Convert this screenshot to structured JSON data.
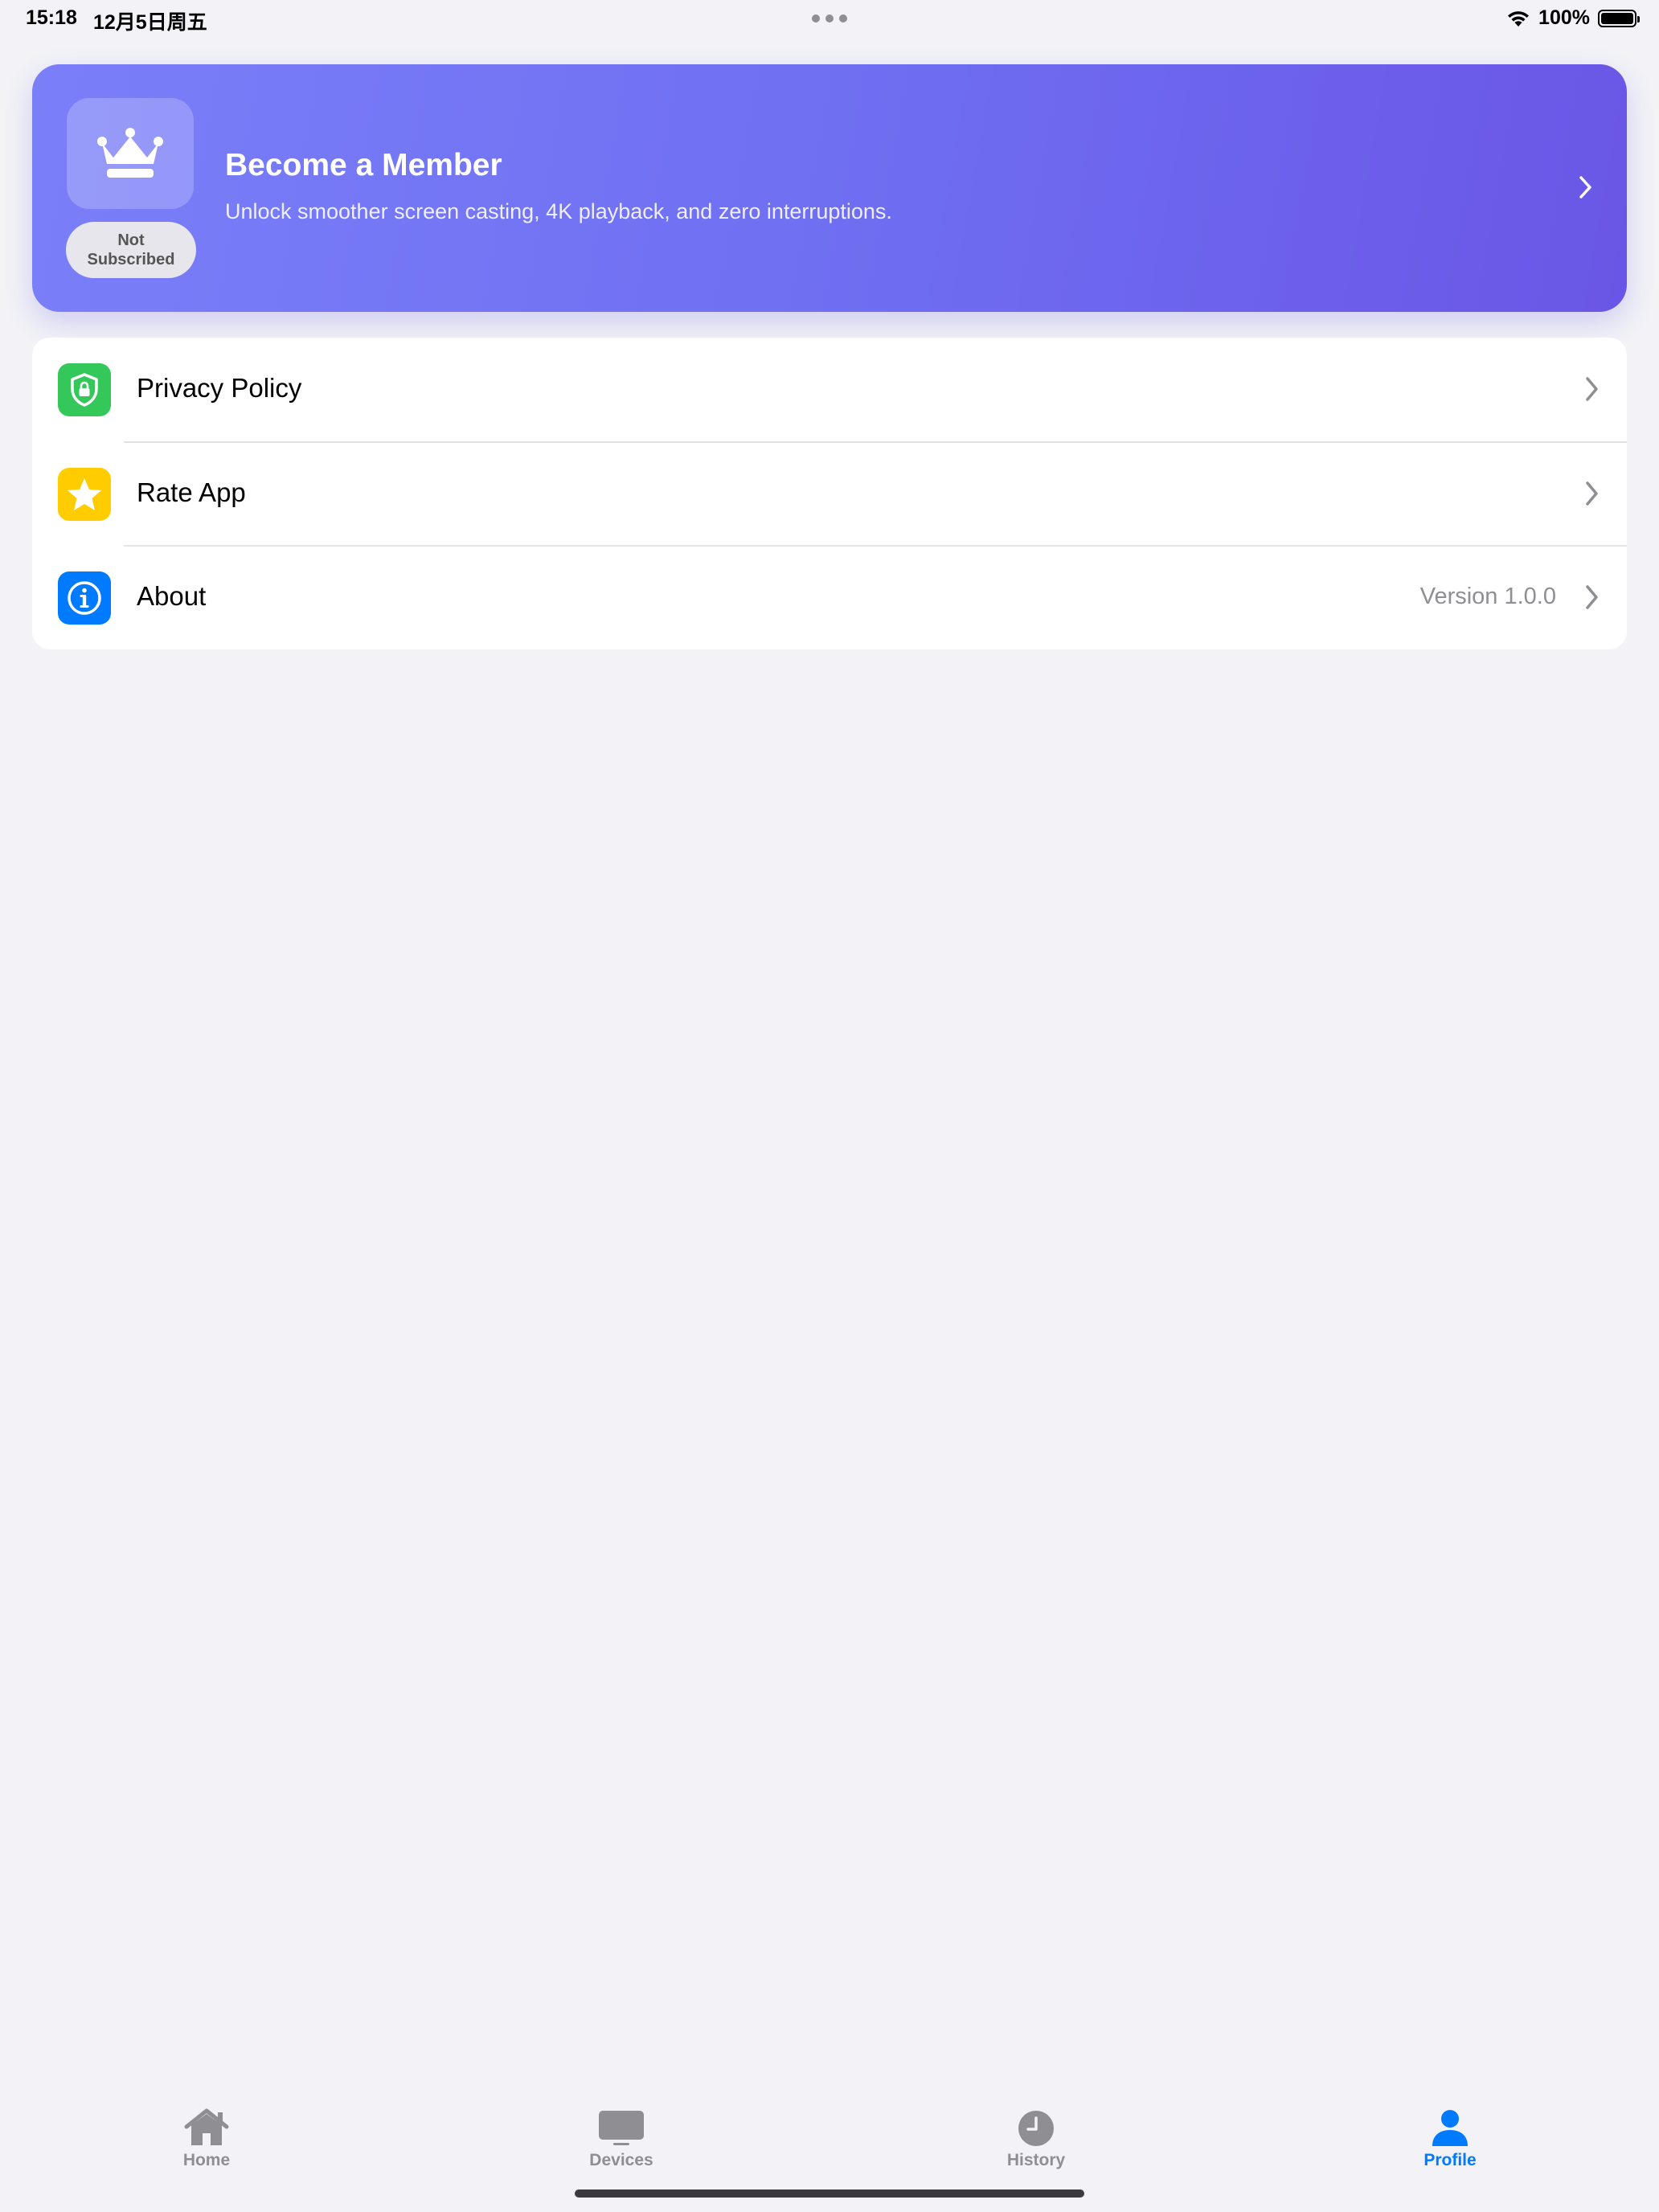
{
  "status_bar": {
    "time": "15:18",
    "date": "12月5日周五",
    "battery_percent": "100%"
  },
  "member_card": {
    "title": "Become a Member",
    "subtitle": "Unlock smoother screen casting, 4K playback, and zero interruptions.",
    "status_line1": "Not",
    "status_line2": "Subscribed",
    "gradient_colors": [
      "#7a7ff8",
      "#6a56e6"
    ]
  },
  "settings": {
    "items": [
      {
        "label": "Privacy Policy",
        "icon": "shield-lock-icon",
        "color": "#34c759"
      },
      {
        "label": "Rate App",
        "icon": "star-icon",
        "color": "#ffcc00"
      },
      {
        "label": "About",
        "icon": "info-icon",
        "color": "#007aff",
        "value": "Version 1.0.0"
      }
    ]
  },
  "tab_bar": {
    "tabs": [
      {
        "label": "Home",
        "icon": "house-icon",
        "active": false
      },
      {
        "label": "Devices",
        "icon": "tv-icon",
        "active": false
      },
      {
        "label": "History",
        "icon": "clock-icon",
        "active": false
      },
      {
        "label": "Profile",
        "icon": "person-icon",
        "active": true
      }
    ],
    "active_color": "#007aff",
    "inactive_color": "#8e8e93"
  }
}
